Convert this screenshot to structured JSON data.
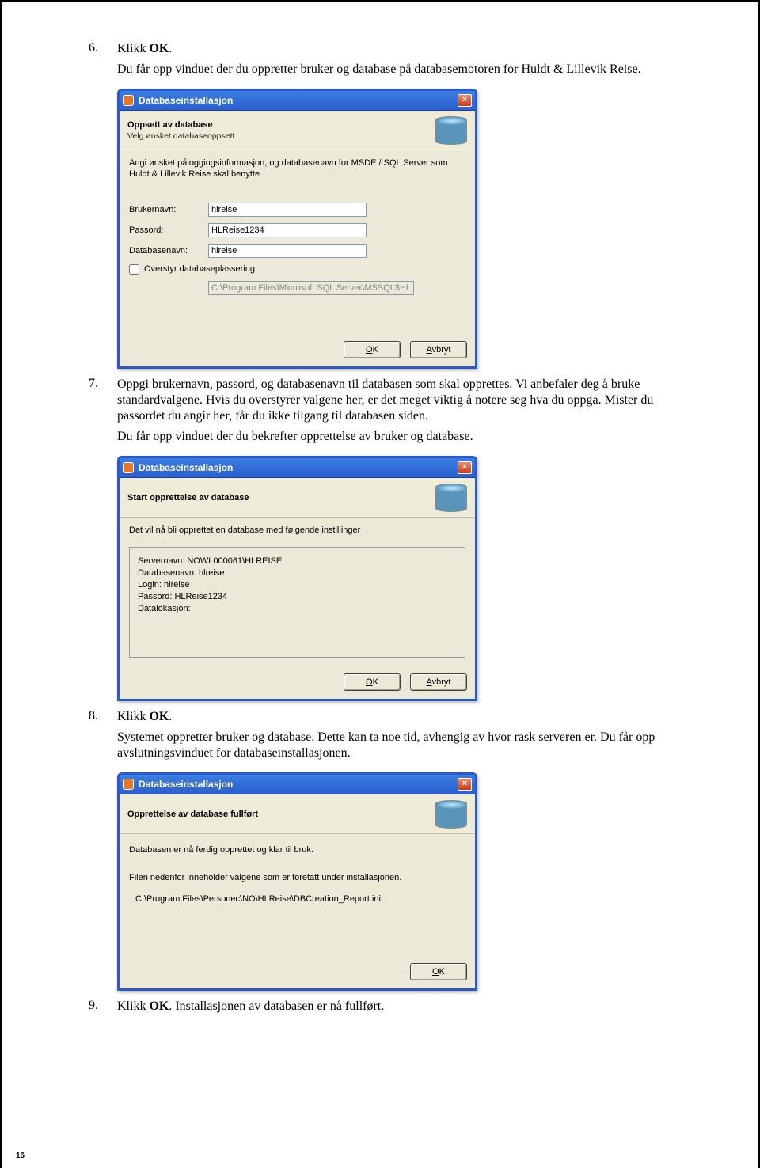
{
  "step6": {
    "num": "6.",
    "text_a": "Klikk ",
    "text_b": "OK",
    "text_c": ".",
    "text2": "Du får opp vinduet der du oppretter bruker og database på databasemotoren for Huldt & Lillevik Reise."
  },
  "dialog1": {
    "title": "Databaseinstallasjon",
    "heading": "Oppsett av database",
    "sub": "Velg ønsket databaseoppsett",
    "desc": "Angi ønsket påloggingsinformasjon, og databasenavn for MSDE / SQL Server som Huldt & Lillevik Reise skal benytte",
    "lbl_user": "Brukernavn:",
    "val_user": "hlreise",
    "lbl_pass": "Passord:",
    "val_pass": "HLReise1234",
    "lbl_db": "Databasenavn:",
    "val_db": "hlreise",
    "chk": "Overstyr databaseplassering",
    "path": "C:\\Program Files\\Microsoft SQL Server\\MSSQL$HLR",
    "ok_u": "O",
    "ok_rest": "K",
    "cancel_u": "A",
    "cancel_rest": "vbryt"
  },
  "step7": {
    "num": "7.",
    "p1": "Oppgi brukernavn, passord, og databasenavn til databasen som skal opprettes. Vi anbefaler deg å bruke standardvalgene. Hvis du overstyrer valgene her, er det meget viktig å notere seg hva du oppga. Mister du passordet du angir her, får du ikke tilgang til databasen siden.",
    "p2": "Du får opp vinduet der du bekrefter opprettelse av bruker og database."
  },
  "dialog2": {
    "title": "Databaseinstallasjon",
    "heading": "Start opprettelse av database",
    "desc": "Det vil nå bli opprettet en database med følgende instillinger",
    "l1": "Servernavn: NOWL000081\\HLREISE",
    "l2": "Databasenavn: hlreise",
    "l3": "Login: hlreise",
    "l4": "Passord: HLReise1234",
    "l5": "Datalokasjon:",
    "ok_u": "O",
    "ok_rest": "K",
    "cancel_u": "A",
    "cancel_rest": "vbryt"
  },
  "step8": {
    "num": "8.",
    "text_a": "Klikk ",
    "text_b": "OK",
    "text_c": ".",
    "p2": "Systemet oppretter bruker og database. Dette kan ta noe tid, avhengig av hvor rask serveren er.   Du får opp avslutningsvinduet for databaseinstallasjonen."
  },
  "dialog3": {
    "title": "Databaseinstallasjon",
    "heading": "Opprettelse av database fullført",
    "l1": "Databasen er nå ferdig opprettet og klar til bruk.",
    "l2": "Filen nedenfor inneholder valgene som er foretatt under installasjonen.",
    "l3": "C:\\Program Files\\Personec\\NO\\HLReise\\DBCreation_Report.ini",
    "ok_u": "O",
    "ok_rest": "K"
  },
  "step9": {
    "num": "9.",
    "text_a": "Klikk ",
    "text_b": "OK",
    "text_c": ". Installasjonen av databasen er nå fullført."
  },
  "page_num": "16"
}
